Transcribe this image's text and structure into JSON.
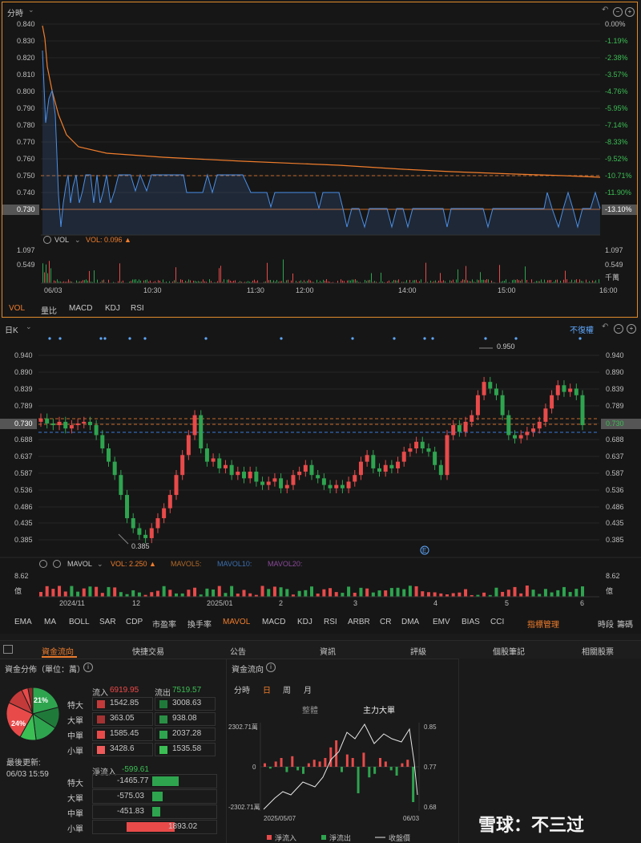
{
  "intraday": {
    "title": "分時",
    "price_ticks": [
      "0.840",
      "0.830",
      "0.820",
      "0.810",
      "0.800",
      "0.790",
      "0.780",
      "0.770",
      "0.760",
      "0.750",
      "0.740",
      "0.730"
    ],
    "pct_ticks": [
      "0.00%",
      "-1.19%",
      "-2.38%",
      "-3.57%",
      "-4.76%",
      "-5.95%",
      "-7.14%",
      "-8.33%",
      "-9.52%",
      "-10.71%",
      "-11.90%",
      "-13.10%"
    ],
    "current_price": "0.730",
    "current_pct": "-13.10%",
    "vol_label": "VOL",
    "vol_value": "VOL: 0.096",
    "vol_ticks_left": [
      "1.097",
      "0.549"
    ],
    "vol_ticks_right": [
      "1.097",
      "0.549",
      "千萬"
    ],
    "time_ticks": [
      "06/03",
      "10:30",
      "11:30",
      "12:00",
      "14:00",
      "15:00",
      "16:00"
    ],
    "indicator_tabs": [
      "VOL",
      "量比",
      "MACD",
      "KDJ",
      "RSI"
    ],
    "active_tab": "VOL"
  },
  "daily": {
    "title": "日K",
    "adjust_label": "不復權",
    "price_ticks": [
      "0.940",
      "0.890",
      "0.839",
      "0.789",
      "0.730",
      "0.688",
      "0.637",
      "0.587",
      "0.536",
      "0.486",
      "0.435",
      "0.385"
    ],
    "right_ticks": [
      "0.940",
      "0.890",
      "0.839",
      "0.789",
      "0.730",
      "0.688",
      "0.637",
      "0.587",
      "0.536",
      "0.486",
      "0.435",
      "0.385"
    ],
    "high_label": "0.950",
    "low_label": "0.385",
    "event_marker": "E",
    "mavol_label": "MAVOL",
    "vol_value": "VOL: 2.250",
    "mavol5": "MAVOL5:",
    "mavol10": "MAVOL10:",
    "mavol20": "MAVOL20:",
    "vol_ticks_left": [
      "8.62",
      "億"
    ],
    "vol_ticks_right": [
      "8.62",
      "億"
    ],
    "date_ticks": [
      "2024/11",
      "12",
      "2025/01",
      "2",
      "3",
      "4",
      "5",
      "6"
    ],
    "indicator_tabs": [
      "EMA",
      "MA",
      "BOLL",
      "SAR",
      "CDP",
      "市盈率",
      "換手率",
      "MAVOL",
      "MACD",
      "KDJ",
      "RSI",
      "ARBR",
      "CR",
      "DMA",
      "EMV",
      "BIAS",
      "CCI"
    ],
    "active_tab": "MAVOL",
    "manage_label": "指標管理",
    "right_tools": [
      "時段",
      "籌碼"
    ]
  },
  "bottom_tabs": [
    "資金流向",
    "快捷交易",
    "公告",
    "資訊",
    "評級",
    "個股筆記",
    "相關股票"
  ],
  "active_bottom_tab": "資金流向",
  "fund_dist": {
    "title": "資金分佈（單位：萬）",
    "pie_labels": [
      "21%",
      "24%"
    ],
    "last_update_label": "最後更新:",
    "last_update": "06/03 15:59",
    "inflow_label": "流入",
    "inflow_total": "6919.95",
    "outflow_label": "流出",
    "outflow_total": "7519.57",
    "rows": [
      {
        "label": "特大",
        "in": "1542.85",
        "out": "3008.63"
      },
      {
        "label": "大單",
        "in": "363.05",
        "out": "938.08"
      },
      {
        "label": "中單",
        "in": "1585.45",
        "out": "2037.28"
      },
      {
        "label": "小單",
        "in": "3428.6",
        "out": "1535.58"
      }
    ],
    "net_label": "淨流入",
    "net_total": "-599.61",
    "net_rows": [
      {
        "label": "特大",
        "value": "-1465.77",
        "v": -1465.77
      },
      {
        "label": "大單",
        "value": "-575.03",
        "v": -575.03
      },
      {
        "label": "中單",
        "value": "-451.83",
        "v": -451.83
      },
      {
        "label": "小單",
        "value": "1893.02",
        "v": 1893.02
      }
    ]
  },
  "fund_flow": {
    "title": "資金流向",
    "periods": [
      "分時",
      "日",
      "周",
      "月"
    ],
    "active_period": "日",
    "subtabs": [
      "整體",
      "主力大單"
    ],
    "active_subtab": "主力大單",
    "left_ticks": [
      "2302.71萬",
      "0",
      "-2302.71萬"
    ],
    "right_ticks": [
      "0.85",
      "0.77",
      "0.68"
    ],
    "date_start": "2025/05/07",
    "date_end": "06/03",
    "legend": [
      "淨流入",
      "淨流出",
      "收盤價"
    ]
  },
  "watermark": "雪球：不三过"
}
